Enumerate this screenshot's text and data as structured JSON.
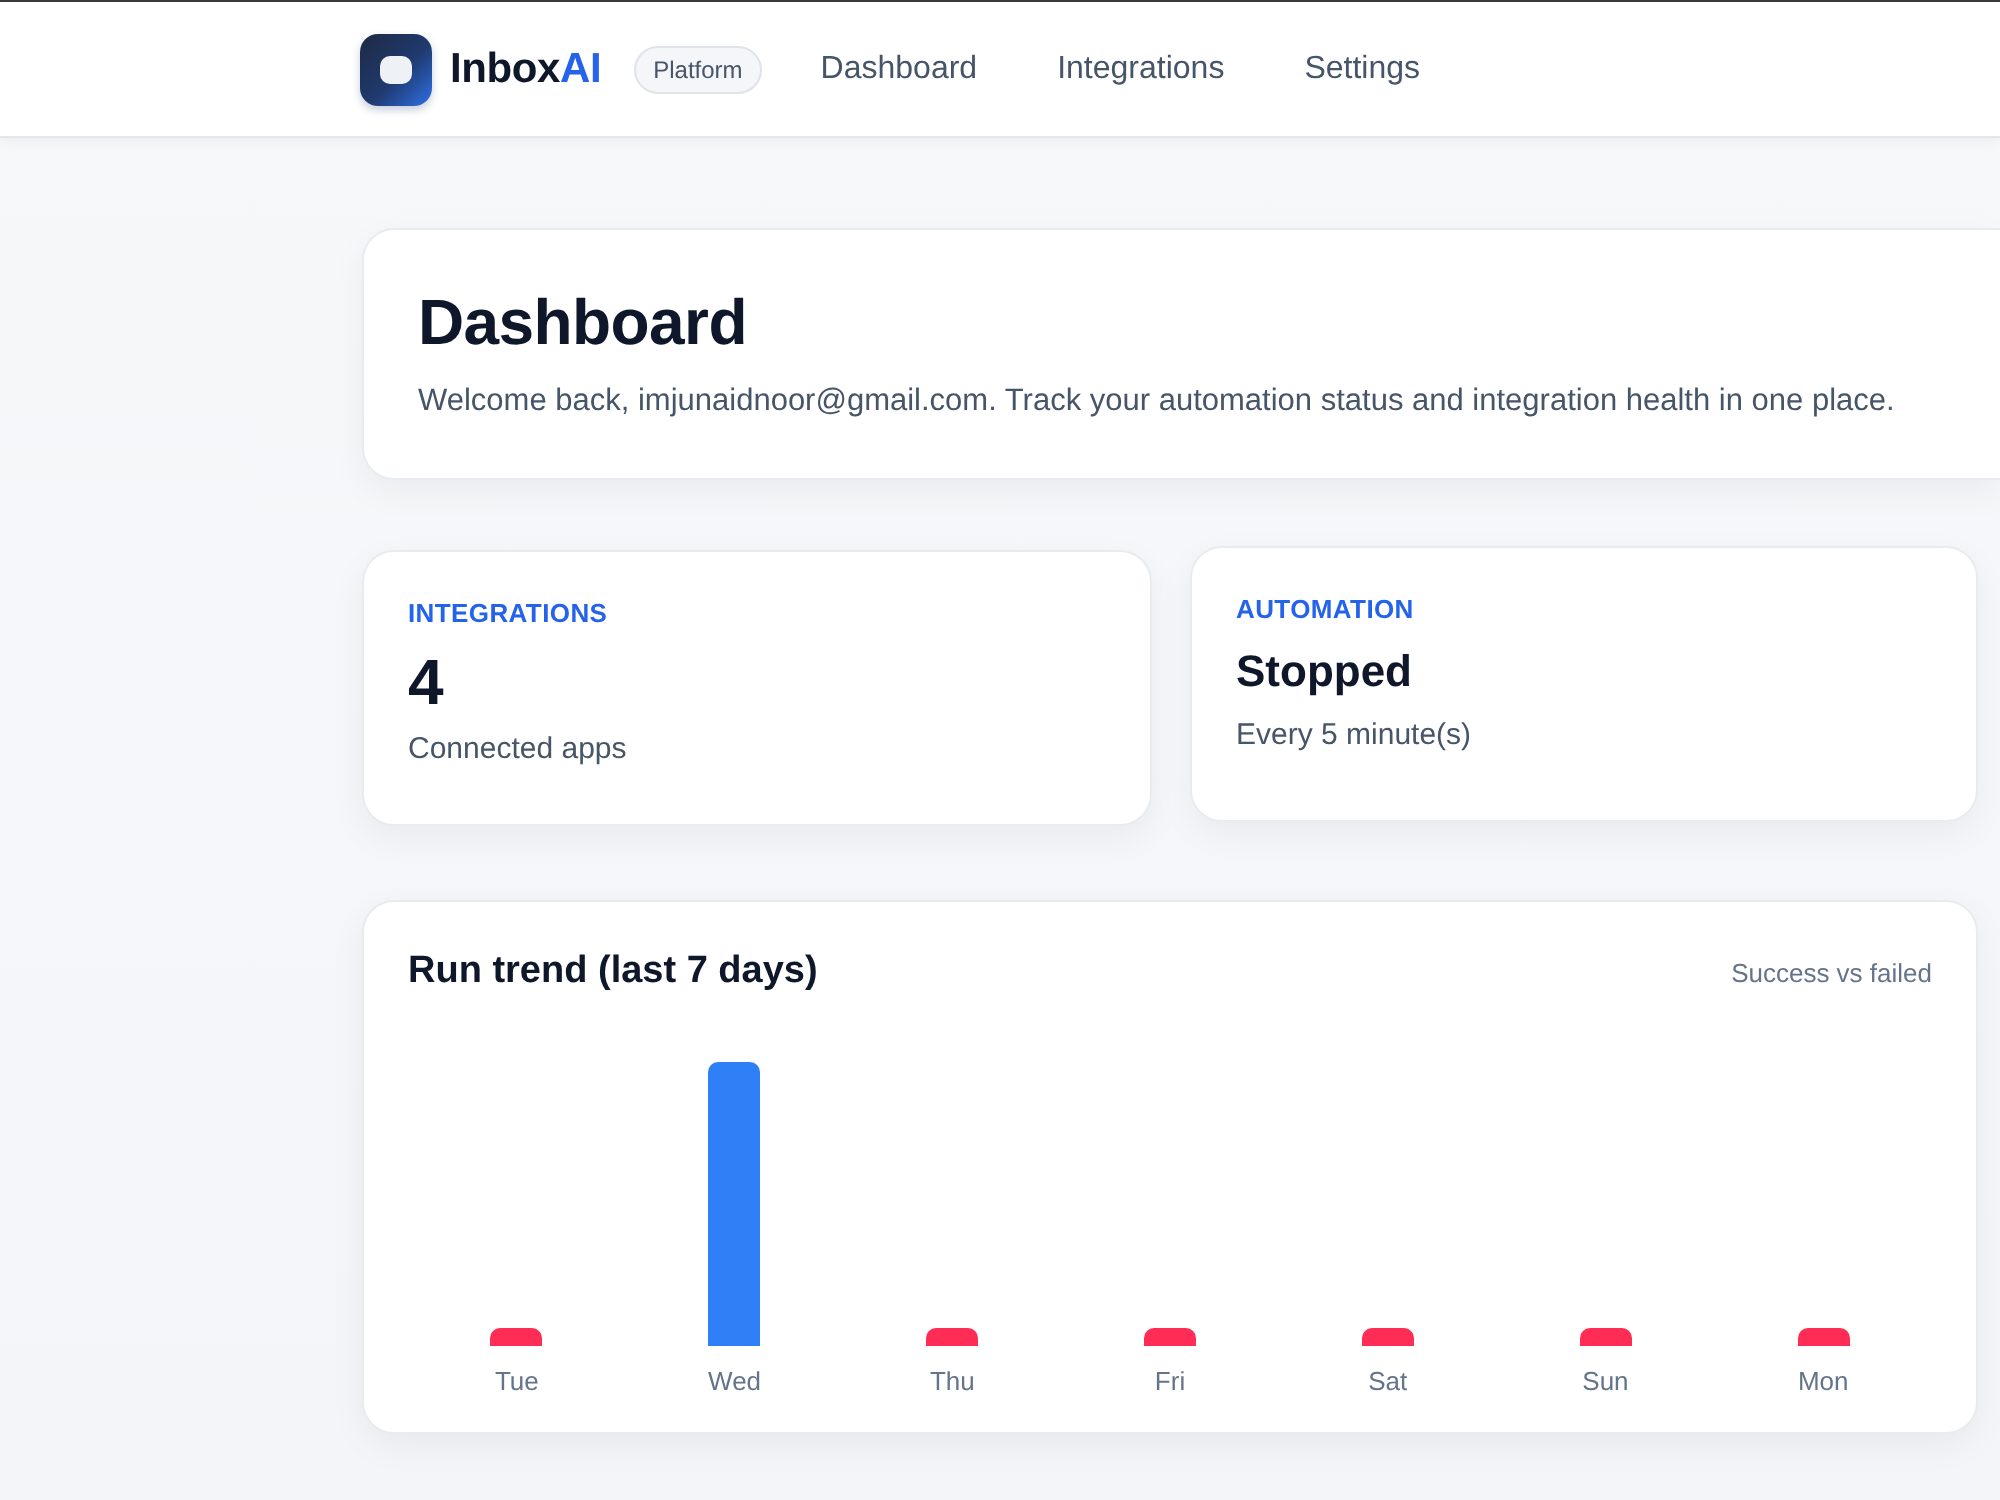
{
  "nav": {
    "brand": {
      "name": "Inbox",
      "accent": "AI"
    },
    "badge": "Platform",
    "links": [
      {
        "label": "Dashboard"
      },
      {
        "label": "Integrations"
      },
      {
        "label": "Settings"
      }
    ]
  },
  "header": {
    "title": "Dashboard",
    "subtitle": "Welcome back, imjunaidnoor@gmail.com. Track your automation status and integration health in one place."
  },
  "stats": [
    {
      "label": "INTEGRATIONS",
      "value": "4",
      "kind": "count",
      "caption": "Connected apps"
    },
    {
      "label": "AUTOMATION",
      "value": "Stopped",
      "kind": "status",
      "caption": "Every 5 minute(s)"
    }
  ],
  "trend": {
    "title": "Run trend (last 7 days)",
    "legend": "Success vs failed",
    "days": [
      {
        "label": "Tue",
        "kind": "failed",
        "color": "#ff2d55"
      },
      {
        "label": "Wed",
        "kind": "success",
        "color": "#2f7ff7"
      },
      {
        "label": "Thu",
        "kind": "failed",
        "color": "#ff2d55"
      },
      {
        "label": "Fri",
        "kind": "failed",
        "color": "#ff2d55"
      },
      {
        "label": "Sat",
        "kind": "failed",
        "color": "#ff2d55"
      },
      {
        "label": "Sun",
        "kind": "failed",
        "color": "#ff2d55"
      },
      {
        "label": "Mon",
        "kind": "failed",
        "color": "#ff2d55"
      }
    ]
  }
}
